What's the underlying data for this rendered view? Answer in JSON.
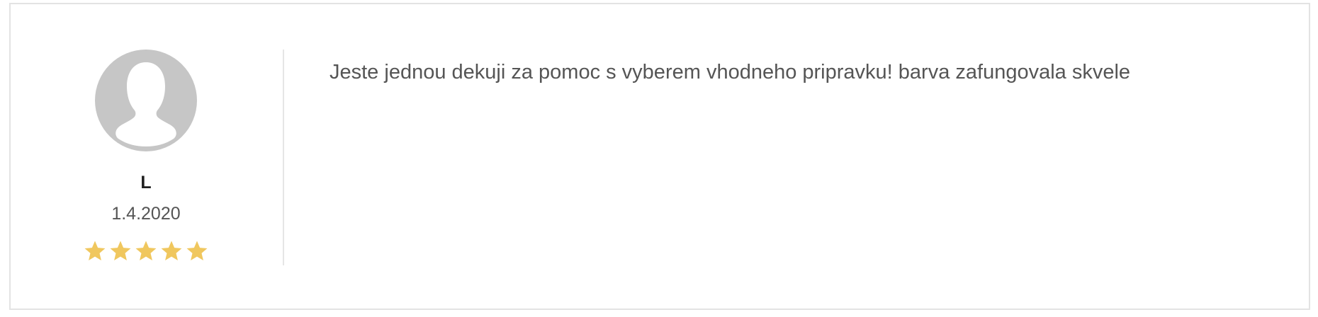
{
  "review": {
    "author": {
      "name": "L",
      "avatar_icon": "default-user-silhouette-icon"
    },
    "date": "1.4.2020",
    "rating": {
      "value": 5,
      "max": 5,
      "star_icon": "star-icon",
      "star_color": "#f0c75e"
    },
    "text": "Jeste jednou dekuji za pomoc s vyberem vhodneho pripravku! barva zafungovala skvele"
  },
  "colors": {
    "avatar_background": "#c6c6c6",
    "avatar_figure": "#ffffff",
    "border": "#e3e3e3",
    "text": "#555555"
  }
}
